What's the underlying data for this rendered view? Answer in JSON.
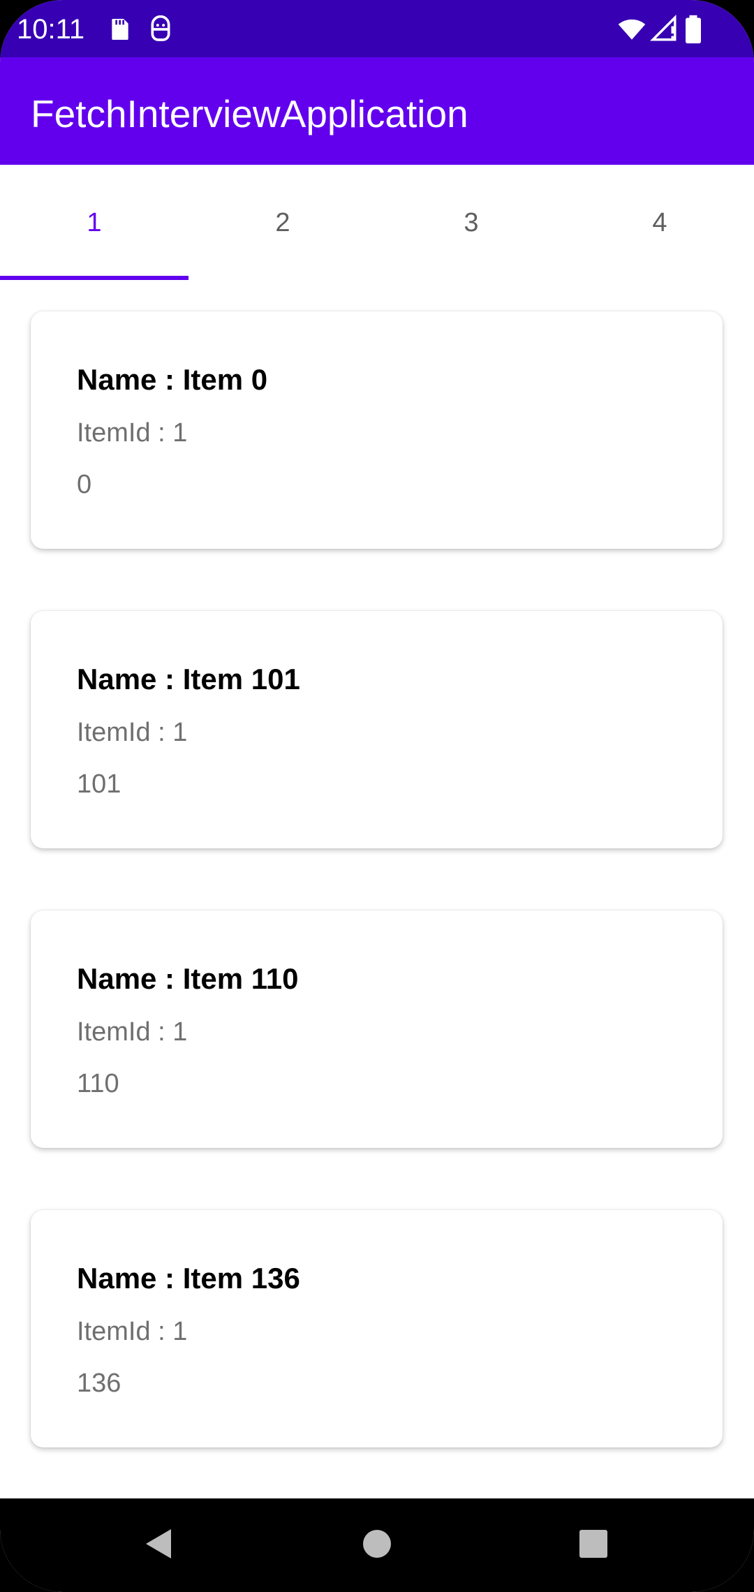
{
  "status_bar": {
    "time": "10:11",
    "icons_left": [
      "sd-card-icon",
      "android-debug-icon"
    ],
    "icons_right": [
      "wifi-icon",
      "signal-icon",
      "battery-icon"
    ]
  },
  "app_bar": {
    "title": "FetchInterviewApplication"
  },
  "tabs": [
    {
      "label": "1",
      "selected": true
    },
    {
      "label": "2",
      "selected": false
    },
    {
      "label": "3",
      "selected": false
    },
    {
      "label": "4",
      "selected": false
    }
  ],
  "items": [
    {
      "name": "Name : Item 0",
      "item_id": "ItemId : 1",
      "value": "0"
    },
    {
      "name": "Name : Item 101",
      "item_id": "ItemId : 1",
      "value": "101"
    },
    {
      "name": "Name : Item 110",
      "item_id": "ItemId : 1",
      "value": "110"
    },
    {
      "name": "Name : Item 136",
      "item_id": "ItemId : 1",
      "value": "136"
    }
  ],
  "nav_bar": {
    "buttons": [
      "back-icon",
      "home-icon",
      "recents-icon"
    ]
  },
  "colors": {
    "status_bar": "#3700b3",
    "app_bar": "#6200ee",
    "tab_active": "#6200ee",
    "tab_inactive": "#5f5f5f"
  }
}
